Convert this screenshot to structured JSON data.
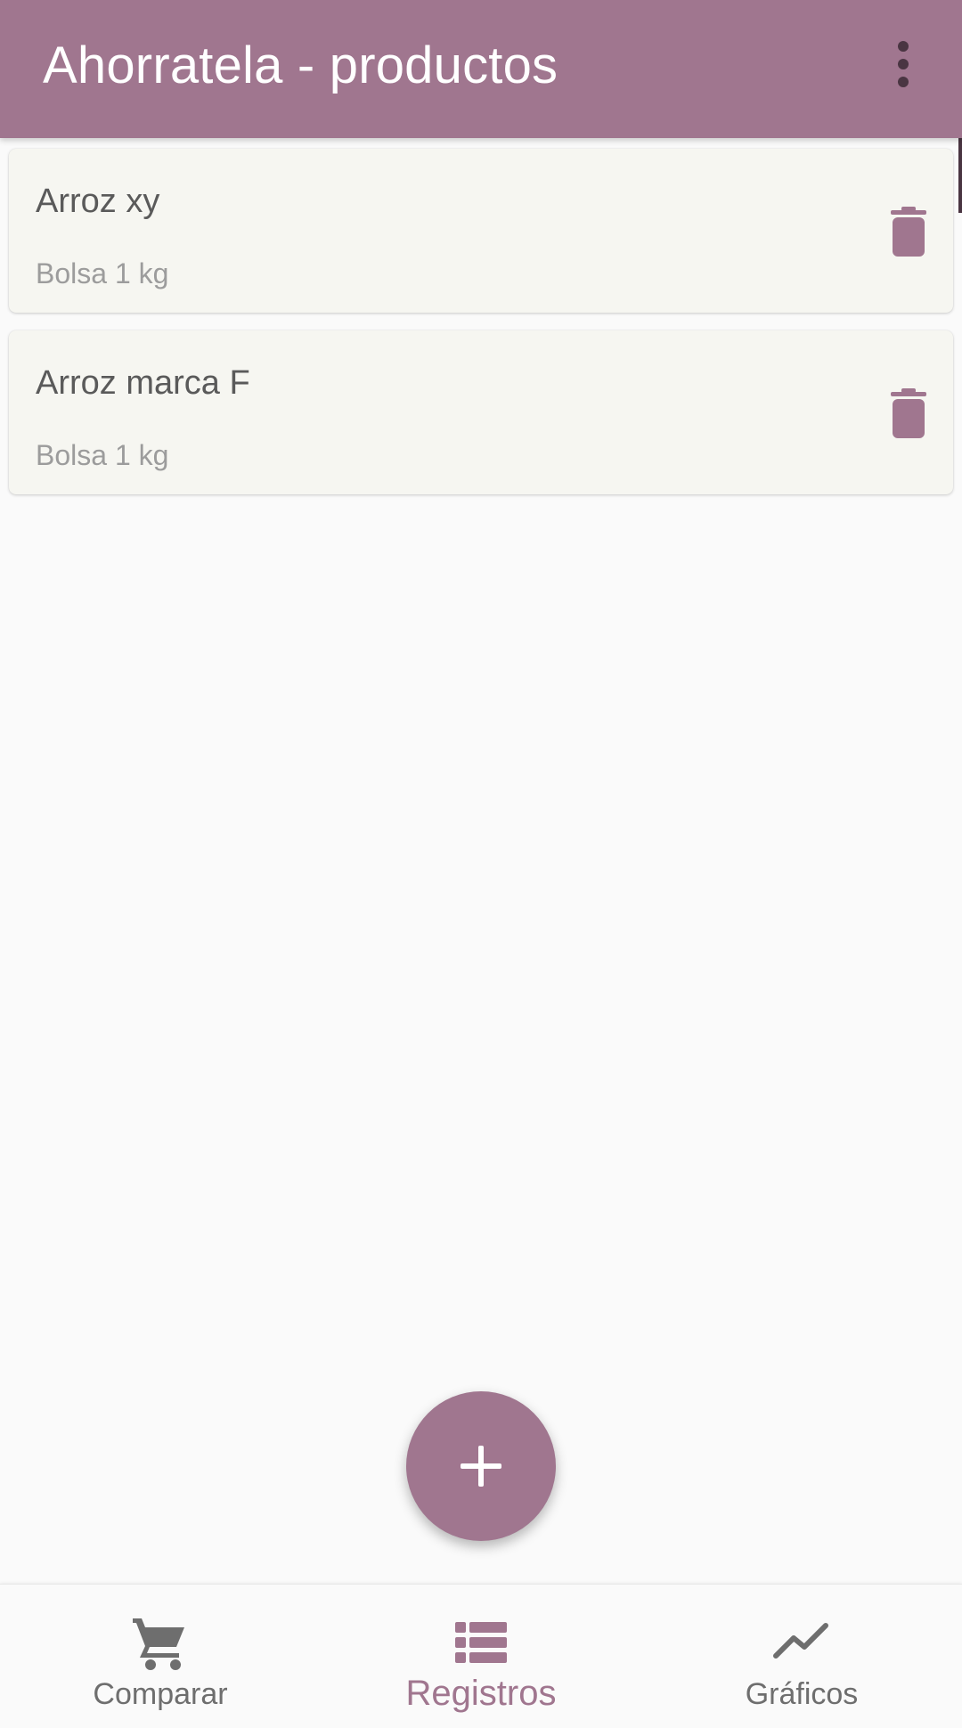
{
  "appbar": {
    "title": "Ahorratela - productos",
    "menu_icon": "more-vert-icon"
  },
  "products": [
    {
      "name": "Arroz xy",
      "detail": "Bolsa 1 kg",
      "action_icon": "delete-icon"
    },
    {
      "name": "Arroz marca F",
      "detail": "Bolsa 1 kg",
      "action_icon": "delete-icon"
    }
  ],
  "fab": {
    "icon": "plus-icon"
  },
  "bottom_nav": {
    "items": [
      {
        "label": "Comparar",
        "icon": "cart-icon",
        "active": false
      },
      {
        "label": "Registros",
        "icon": "list-icon",
        "active": true
      },
      {
        "label": "Gráficos",
        "icon": "trending-icon",
        "active": false
      }
    ]
  },
  "colors": {
    "primary": "#a0768f",
    "card_background": "#f6f6f1",
    "page_background": "#fafafa"
  }
}
